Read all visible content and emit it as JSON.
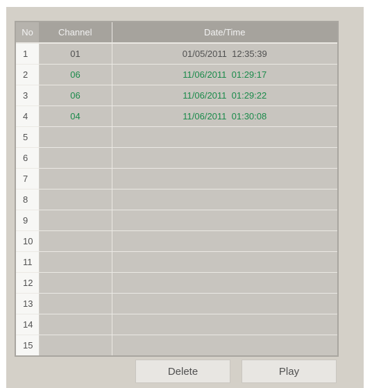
{
  "table": {
    "headers": {
      "no": "No",
      "channel": "Channel",
      "datetime": "Date/Time"
    },
    "rows": [
      {
        "no": "1",
        "channel": "01",
        "datetime": "01/05/2011  12:35:39",
        "color": "#505050"
      },
      {
        "no": "2",
        "channel": "06",
        "datetime": "11/06/2011  01:29:17",
        "color": "#1a8a4a"
      },
      {
        "no": "3",
        "channel": "06",
        "datetime": "11/06/2011  01:29:22",
        "color": "#1a8a4a"
      },
      {
        "no": "4",
        "channel": "04",
        "datetime": "11/06/2011  01:30:08",
        "color": "#1a8a4a"
      },
      {
        "no": "5",
        "channel": "",
        "datetime": ""
      },
      {
        "no": "6",
        "channel": "",
        "datetime": ""
      },
      {
        "no": "7",
        "channel": "",
        "datetime": ""
      },
      {
        "no": "8",
        "channel": "",
        "datetime": ""
      },
      {
        "no": "9",
        "channel": "",
        "datetime": ""
      },
      {
        "no": "10",
        "channel": "",
        "datetime": ""
      },
      {
        "no": "11",
        "channel": "",
        "datetime": ""
      },
      {
        "no": "12",
        "channel": "",
        "datetime": ""
      },
      {
        "no": "13",
        "channel": "",
        "datetime": ""
      },
      {
        "no": "14",
        "channel": "",
        "datetime": ""
      },
      {
        "no": "15",
        "channel": "",
        "datetime": ""
      }
    ]
  },
  "buttons": {
    "delete": "Delete",
    "play": "Play"
  }
}
